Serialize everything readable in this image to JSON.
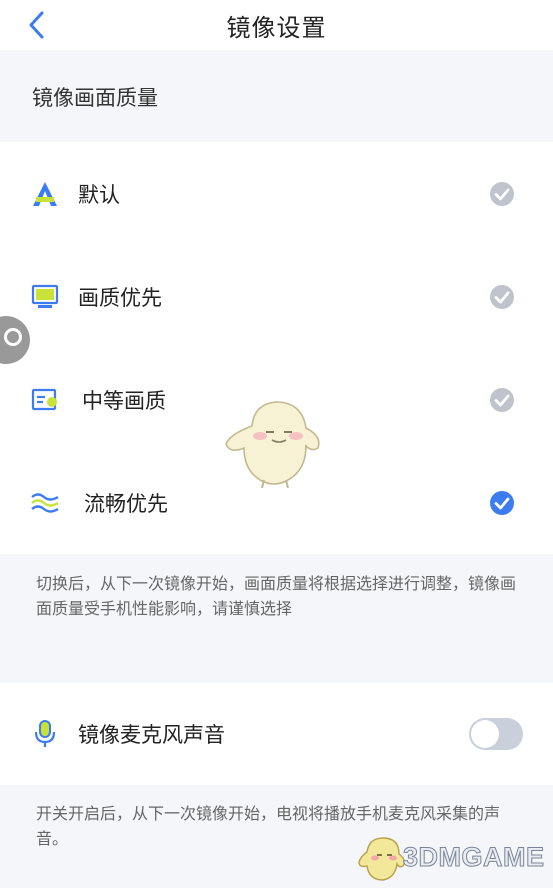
{
  "header": {
    "title": "镜像设置"
  },
  "section": {
    "title": "镜像画面质量"
  },
  "options": [
    {
      "label": "默认",
      "selected": false,
      "icon": "letter-a-icon"
    },
    {
      "label": "画质优先",
      "selected": false,
      "icon": "monitor-icon"
    },
    {
      "label": "中等画质",
      "selected": false,
      "icon": "image-card-icon"
    },
    {
      "label": "流畅优先",
      "selected": true,
      "icon": "waves-icon"
    }
  ],
  "quality_note": "切换后，从下一次镜像开始，画面质量将根据选择进行调整，镜像画面质量受手机性能影响，请谨慎选择",
  "mic": {
    "label": "镜像麦克风声音",
    "enabled": false,
    "icon": "microphone-icon"
  },
  "mic_note": "开关开启后，从下一次镜像开始，电视将播放手机麦克风采集的声音。",
  "watermark": {
    "text": "3DMGAME"
  },
  "colors": {
    "accent": "#3d7cf0",
    "check_inactive": "#bfc4cc",
    "toggle_off": "#c9cfdb"
  }
}
